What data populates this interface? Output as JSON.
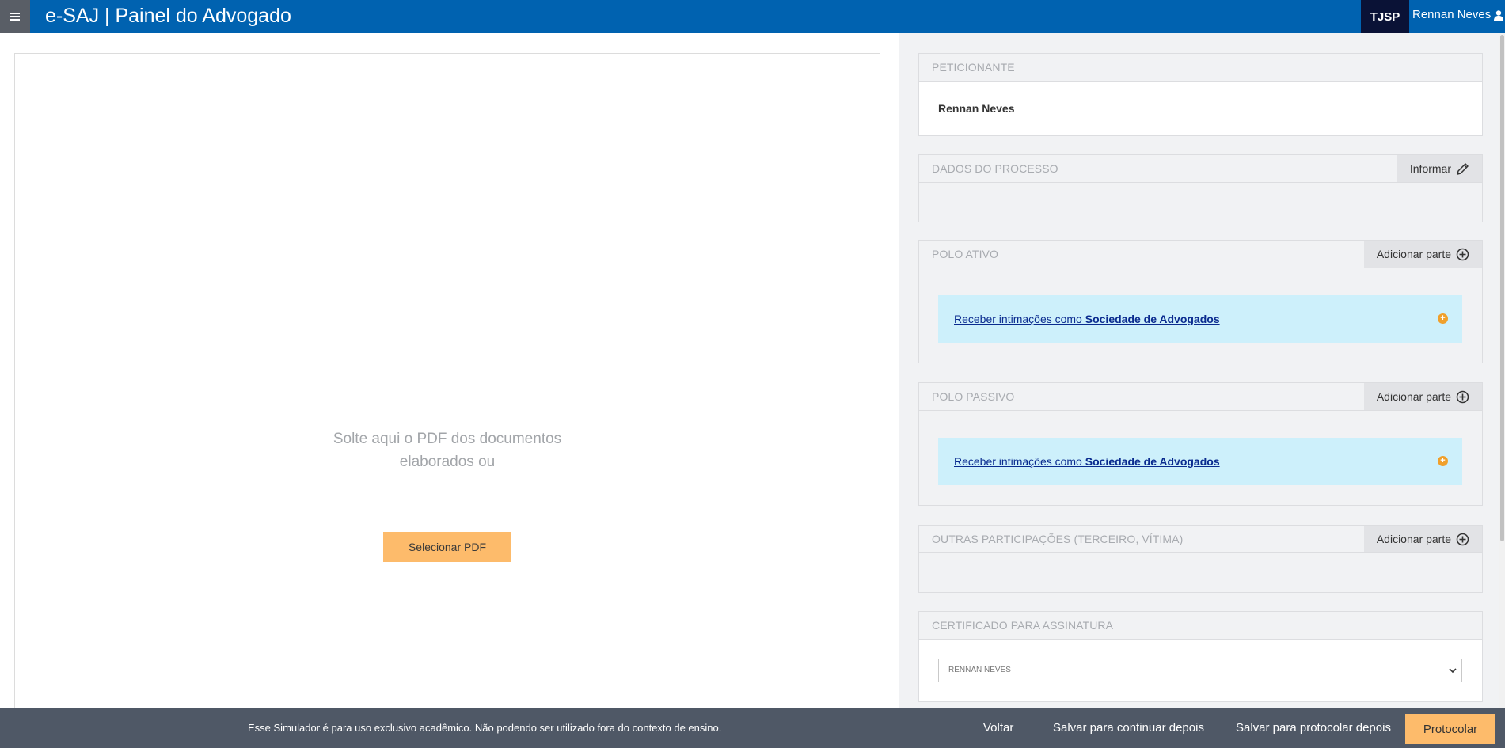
{
  "header": {
    "menu_icon": "hamburger-icon",
    "title": "e-SAJ | Painel do Advogado",
    "court": "TJSP",
    "user": "Rennan Neves",
    "user_icon": "user-icon"
  },
  "upload": {
    "drop_text_line1": "Solte aqui o PDF dos documentos",
    "drop_text_line2": "elaborados ou",
    "select_button": "Selecionar PDF"
  },
  "peticionante": {
    "title": "PETICIONANTE",
    "name": "Rennan Neves"
  },
  "dados_processo": {
    "title": "DADOS DO PROCESSO",
    "action": "Informar",
    "action_icon": "pencil-icon"
  },
  "polo_ativo": {
    "title": "POLO ATIVO",
    "action": "Adicionar parte",
    "action_icon": "plus-circle-icon",
    "link_prefix": "Receber intimações como ",
    "link_bold": "Sociedade de Advogados"
  },
  "polo_passivo": {
    "title": "POLO PASSIVO",
    "action": "Adicionar parte",
    "action_icon": "plus-circle-icon",
    "link_prefix": "Receber intimações como ",
    "link_bold": "Sociedade de Advogados"
  },
  "outras": {
    "title": "OUTRAS PARTICIPAÇÕES (TERCEIRO, VÍTIMA)",
    "action": "Adicionar parte",
    "action_icon": "plus-circle-icon"
  },
  "certificado": {
    "title": "CERTIFICADO PARA ASSINATURA",
    "selected": "RENNAN NEVES"
  },
  "footer": {
    "notice": "Esse Simulador é para uso exclusivo acadêmico. Não podendo ser utilizado fora do contexto de ensino.",
    "voltar": "Voltar",
    "salvar_continuar": "Salvar para continuar depois",
    "salvar_protocolar": "Salvar para protocolar depois",
    "protocolar": "Protocolar"
  },
  "colors": {
    "header_blue": "#0062b0",
    "accent_orange": "#fdbb6b",
    "info_bg": "#cdf0fb",
    "footer_bg": "#4f5866"
  }
}
